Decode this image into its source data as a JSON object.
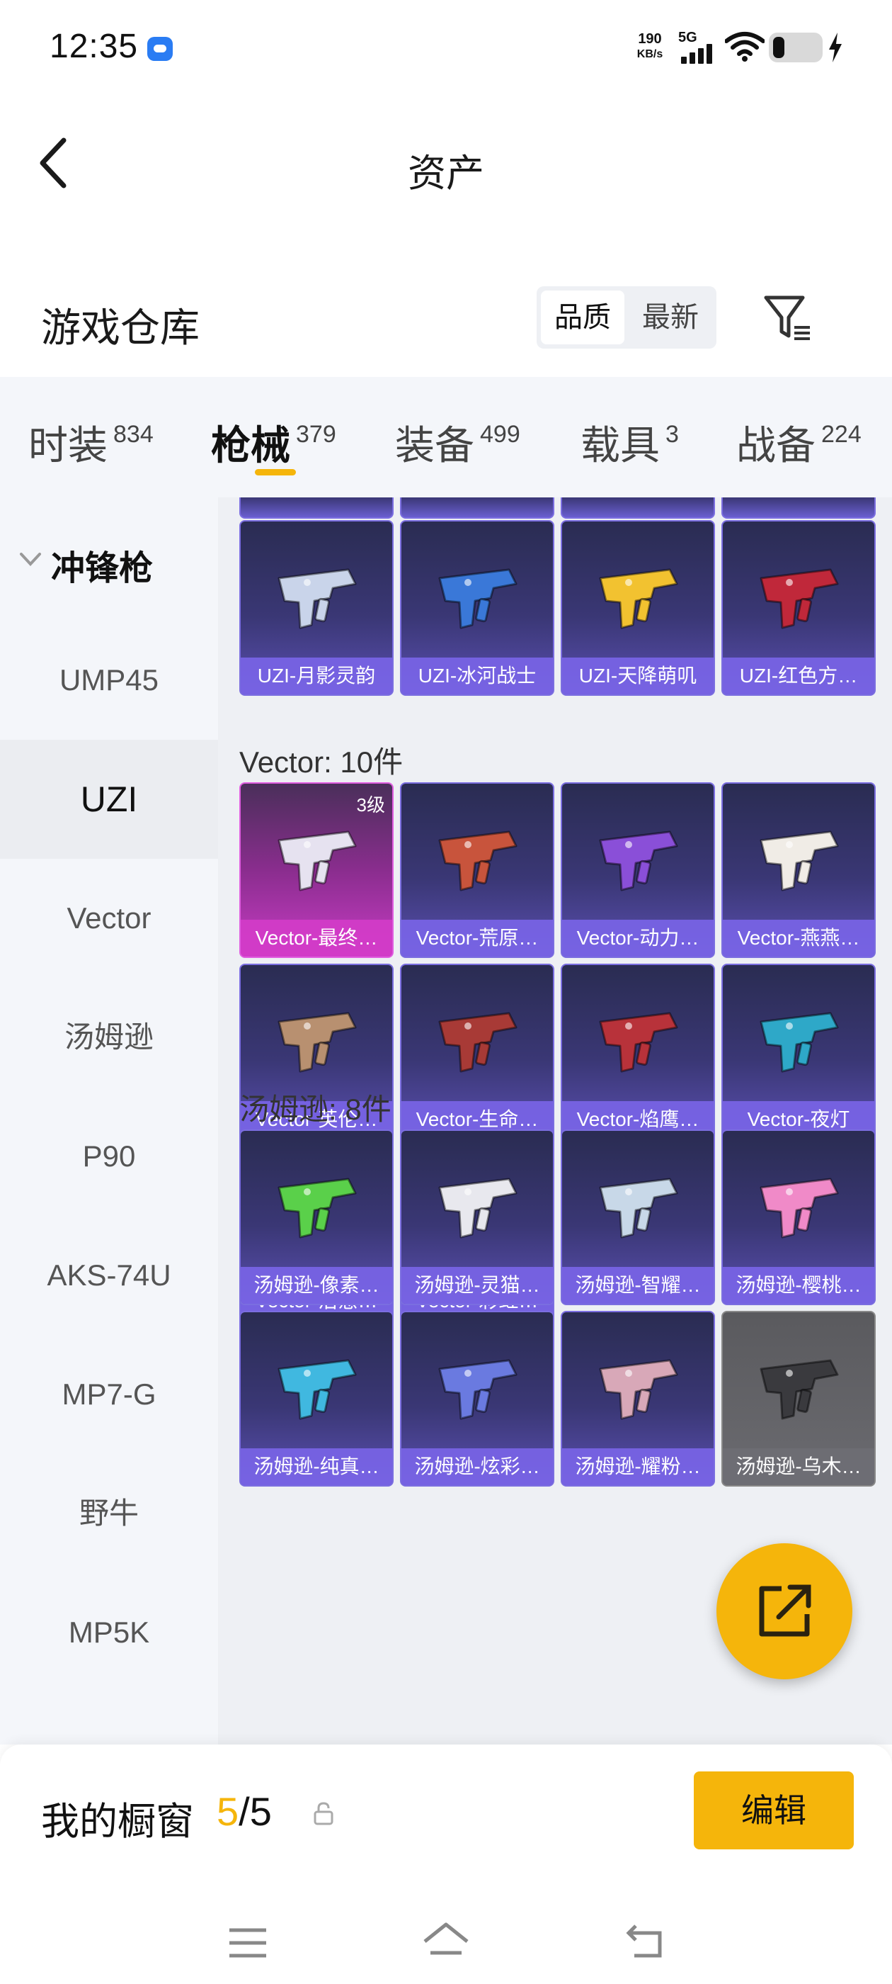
{
  "status_bar": {
    "time": "12:35",
    "net_speed_value": "190",
    "net_speed_unit": "KB/s",
    "network": "5G",
    "icons": [
      "app-notification-icon",
      "signal-icon",
      "wifi-icon",
      "battery-icon",
      "charging-icon"
    ]
  },
  "header": {
    "title": "资产",
    "back_icon": "back-arrow-icon"
  },
  "warehouse": {
    "title": "游戏仓库",
    "sort_options": [
      "品质",
      "最新"
    ],
    "active_sort": "品质",
    "filter_icon": "filter-icon"
  },
  "tabs": [
    {
      "label": "时装",
      "count": "834"
    },
    {
      "label": "枪械",
      "count": "379"
    },
    {
      "label": "装备",
      "count": "499"
    },
    {
      "label": "载具",
      "count": "3"
    },
    {
      "label": "战备",
      "count": "224"
    }
  ],
  "active_tab": "枪械",
  "sidebar": {
    "group": "冲锋枪",
    "items": [
      "UMP45",
      "UZI",
      "Vector",
      "汤姆逊",
      "P90",
      "AKS-74U",
      "MP7-G",
      "野牛",
      "MP5K"
    ],
    "active": "UZI"
  },
  "groups": [
    {
      "title": "",
      "items": [
        {
          "label": "UZI-月影灵韵",
          "color": "#c9d4ea"
        },
        {
          "label": "UZI-冰河战士",
          "color": "#3a78d8"
        },
        {
          "label": "UZI-天降萌叽",
          "color": "#f2c230"
        },
        {
          "label": "UZI-红色方…",
          "color": "#c0283a"
        }
      ]
    },
    {
      "title": "Vector: 10件",
      "items": [
        {
          "label": "Vector-最终…",
          "badge": "3级",
          "rarity": "legendary",
          "color": "#e6e2f0"
        },
        {
          "label": "Vector-荒原…",
          "color": "#c8543c"
        },
        {
          "label": "Vector-动力…",
          "color": "#8a4fd8"
        },
        {
          "label": "Vector-燕燕…",
          "color": "#f0ece6"
        },
        {
          "label": "Vector-英伦…",
          "color": "#b89070"
        },
        {
          "label": "Vector-生命…",
          "color": "#a83a36"
        },
        {
          "label": "Vector-焰鹰…",
          "color": "#b8323a"
        },
        {
          "label": "Vector-夜灯",
          "color": "#2ea8c8"
        },
        {
          "label": "Vector-治愈…",
          "color": "#e8e8f0"
        },
        {
          "label": "Vector-彩虹…",
          "color": "#e04a8a"
        }
      ]
    },
    {
      "title": "汤姆逊: 8件",
      "items": [
        {
          "label": "汤姆逊-像素…",
          "color": "#5ad04a"
        },
        {
          "label": "汤姆逊-灵猫…",
          "color": "#e8e8ee"
        },
        {
          "label": "汤姆逊-智耀…",
          "color": "#c8d8e8"
        },
        {
          "label": "汤姆逊-樱桃…",
          "color": "#f08ac8"
        },
        {
          "label": "汤姆逊-纯真…",
          "color": "#40b8e0"
        },
        {
          "label": "汤姆逊-炫彩…",
          "color": "#6a7ae0"
        },
        {
          "label": "汤姆逊-耀粉…",
          "color": "#d8a8b8"
        },
        {
          "label": "汤姆逊-乌木…",
          "rarity": "common",
          "color": "#3a3a3e"
        }
      ]
    }
  ],
  "showcase": {
    "label": "我的橱窗",
    "current": "5",
    "separator": "/",
    "total": "5",
    "edit_label": "编辑"
  },
  "fab_icon": "share-icon",
  "nav_icons": [
    "menu-icon",
    "home-icon",
    "back-icon"
  ],
  "colors": {
    "accent": "#f5b50b",
    "card_border": "#7b6ee0",
    "card_label": "#7864e6",
    "legendary": "#c73cc4"
  }
}
